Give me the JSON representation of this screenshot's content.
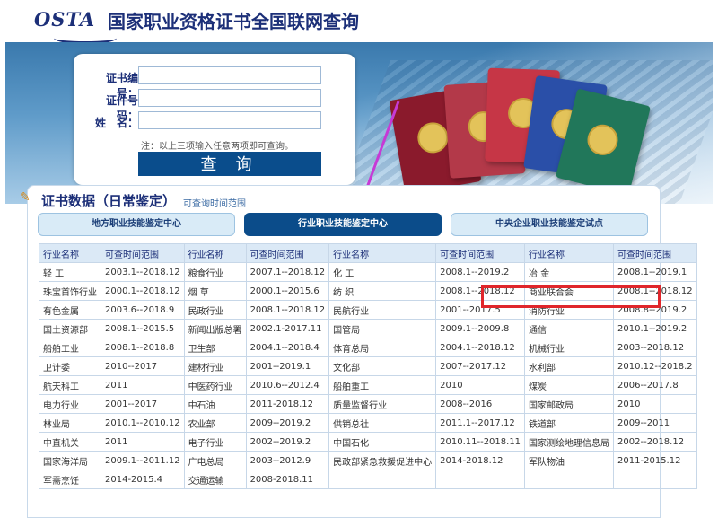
{
  "header": {
    "logo_text": "OSTA",
    "title": "国家职业资格证书全国联网查询"
  },
  "form": {
    "cert_no_label": "证书编号：",
    "id_no_label": "证件号码：",
    "name_label": "姓　名：",
    "cert_no_value": "",
    "id_no_value": "",
    "name_value": "",
    "note": "注：以上三项输入任意两项即可查询。",
    "query_button": "查 询"
  },
  "section": {
    "title": "证书数据（日常鉴定）",
    "subtitle": "可查询时间范围"
  },
  "tabs": [
    {
      "label": "地方职业技能鉴定中心"
    },
    {
      "label": "行业职业技能鉴定中心"
    },
    {
      "label": "中央企业职业技能鉴定试点"
    }
  ],
  "colors": {
    "brand": "#1c2f78",
    "active_tab": "#0b4c8a",
    "highlight": "#e0262b",
    "annotation_arrow": "#c63ad6"
  },
  "table": {
    "headers": [
      "行业名称",
      "可查时间范围",
      "行业名称",
      "可查时间范围",
      "行业名称",
      "可查时间范围",
      "行业名称",
      "可查时间范围"
    ],
    "rows": [
      [
        "轻 工",
        "2003.1--2018.12",
        "粮食行业",
        "2007.1--2018.12",
        "化 工",
        "2008.1--2019.2",
        "冶 金",
        "2008.1--2019.1"
      ],
      [
        "珠宝首饰行业",
        "2000.1--2018.12",
        "烟 草",
        "2000.1--2015.6",
        "纺 织",
        "2008.1--2018.12",
        "商业联合会",
        "2008.1--2018.12"
      ],
      [
        "有色金属",
        "2003.6--2018.9",
        "民政行业",
        "2008.1--2018.12",
        "民航行业",
        "2001--2017.5",
        "消防行业",
        "2008.8--2019.2"
      ],
      [
        "国土资源部",
        "2008.1--2015.5",
        "新闻出版总署",
        "2002.1-2017.11",
        "国管局",
        "2009.1--2009.8",
        "通信",
        "2010.1--2019.2"
      ],
      [
        "船舶工业",
        "2008.1--2018.8",
        "卫生部",
        "2004.1--2018.4",
        "体育总局",
        "2004.1--2018.12",
        "机械行业",
        "2003--2018.12"
      ],
      [
        "卫计委",
        "2010--2017",
        "建材行业",
        "2001--2019.1",
        "文化部",
        "2007--2017.12",
        "水利部",
        "2010.12--2018.2"
      ],
      [
        "航天科工",
        "2011",
        "中医药行业",
        "2010.6--2012.4",
        "船舶重工",
        "2010",
        "煤炭",
        "2006--2017.8"
      ],
      [
        "电力行业",
        "2001--2017",
        "中石油",
        "2011-2018.12",
        "质量监督行业",
        "2008--2016",
        "国家邮政局",
        "2010"
      ],
      [
        "林业局",
        "2010.1--2010.12",
        "农业部",
        "2009--2019.2",
        "供销总社",
        "2011.1--2017.12",
        "铁道部",
        "2009--2011"
      ],
      [
        "中直机关",
        "2011",
        "电子行业",
        "2002--2019.2",
        "中国石化",
        "2010.11--2018.11",
        "国家测绘地理信息局",
        "2002--2018.12"
      ],
      [
        "国家海洋局",
        "2009.1--2011.12",
        "广电总局",
        "2003--2012.9",
        "民政部紧急救援促进中心",
        "2014-2018.12",
        "军队物油",
        "2011-2015.12"
      ],
      [
        "军需烹饪",
        "2014-2015.4",
        "交通运输",
        "2008-2018.11",
        "",
        "",
        "",
        ""
      ]
    ]
  }
}
